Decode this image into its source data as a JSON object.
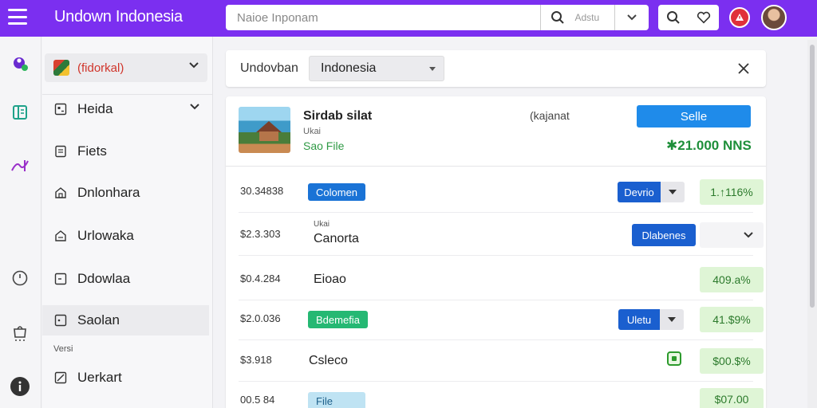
{
  "app": {
    "brand": "Undown Indonesia"
  },
  "search": {
    "placeholder": "Naioe Inponam",
    "button_text": "Adstu"
  },
  "sidebar": {
    "selector_label": "(fidorkal)",
    "items": [
      {
        "label": "Heida",
        "icon": "grid-icon"
      },
      {
        "label": "Fiets",
        "icon": "document-icon"
      },
      {
        "label": "Dnlonhara",
        "icon": "home-icon"
      },
      {
        "label": "Urlowaka",
        "icon": "home-icon"
      },
      {
        "label": "Ddowlaa",
        "icon": "frame-icon"
      },
      {
        "label": "Saolan",
        "icon": "frame-icon"
      }
    ],
    "section_label": "Versi",
    "last_item": {
      "label": "Uerkart",
      "icon": "edit-icon"
    }
  },
  "filter": {
    "label": "Undovban",
    "selected": "Indonesia"
  },
  "product": {
    "title": "Sirdab silat",
    "subtitle": "Ukai",
    "link": "Sao File",
    "location": "(kajanat",
    "button": "Selle",
    "price": "✱21.000 NNS"
  },
  "rows": [
    {
      "amount": "30.34838",
      "tag": "Colomen",
      "tag_style": "blue",
      "action": "Devrio",
      "pct": "1.↑116%"
    },
    {
      "amount": "$2.3.303",
      "small": "Ukai",
      "text": "Canorta",
      "button": "Dlabenes"
    },
    {
      "amount": "$0.4.284",
      "text": "Eioao",
      "pct": "409.a%"
    },
    {
      "amount": "$2.0.036",
      "tag": "Bdemefia",
      "tag_style": "green",
      "action": "Uletu",
      "pct": "41.$9%"
    },
    {
      "amount": "$3.918",
      "text": "Csleco",
      "pct": "$00.$%"
    },
    {
      "amount": "00.5 84",
      "tag": "File",
      "tag_style": "light",
      "pct": "$07.00"
    }
  ],
  "colors": {
    "topbar": "#7b2ff0",
    "primary": "#1f8bea",
    "success": "#1e8f3a",
    "danger": "#e0303a"
  }
}
